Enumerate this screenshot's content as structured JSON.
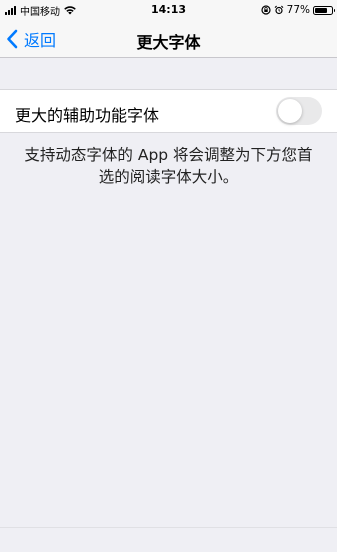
{
  "status_bar": {
    "carrier": "中国移动",
    "time": "14:13",
    "battery_percent": "77%",
    "battery_level": 0.77,
    "icons": [
      "signal-icon",
      "wifi-icon",
      "rotation-lock-icon",
      "alarm-icon",
      "battery-icon"
    ]
  },
  "nav": {
    "back_label": "返回",
    "title": "更大字体"
  },
  "setting": {
    "label": "更大的辅助功能字体",
    "toggle_on": false,
    "toggle_off_color": "#e9e9ea",
    "description": "支持动态字体的 App 将会调整为下方您首选的阅读字体大小。"
  },
  "colors": {
    "accent": "#007aff",
    "background": "#efeff4"
  }
}
